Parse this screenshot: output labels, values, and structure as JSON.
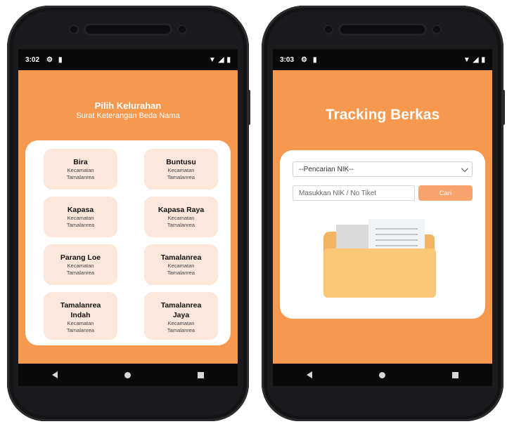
{
  "left_phone": {
    "status": {
      "time": "3:02"
    },
    "title": "Pilih Kelurahan",
    "subtitle": "Surat Keterangan Beda Nama",
    "kelurahan": [
      {
        "name": "Bira",
        "sub1": "Kecamatan",
        "sub2": "Tamalanrea"
      },
      {
        "name": "Buntusu",
        "sub1": "Kecamatan",
        "sub2": "Tamalanrea"
      },
      {
        "name": "Kapasa",
        "sub1": "Kecamatan",
        "sub2": "Tamalanrea"
      },
      {
        "name": "Kapasa Raya",
        "sub1": "Kecamatan",
        "sub2": "Tamalanrea"
      },
      {
        "name": "Parang Loe",
        "sub1": "Kecamatan",
        "sub2": "Tamalanrea"
      },
      {
        "name": "Tamalanrea",
        "sub1": "Kecamatan",
        "sub2": "Tamalanrea"
      },
      {
        "name_line1": "Tamalanrea",
        "name_line2": "Indah",
        "sub1": "Kecamatan",
        "sub2": "Tamalanrea"
      },
      {
        "name_line1": "Tamalanrea",
        "name_line2": "Jaya",
        "sub1": "Kecamatan",
        "sub2": "Tamalanrea"
      }
    ]
  },
  "right_phone": {
    "status": {
      "time": "3:03"
    },
    "title": "Tracking Berkas",
    "select": {
      "selected": "--Pencarian NIK--"
    },
    "search": {
      "placeholder": "Masukkan NIK / No Tiket",
      "button": "Cari"
    }
  },
  "colors": {
    "accent": "#f7984f",
    "tile": "#fde6da",
    "button": "#f7a36b",
    "folder": "#f8c272"
  },
  "icons": [
    "gear-icon",
    "sd-card-icon",
    "wifi-icon",
    "signal-icon",
    "battery-icon",
    "back-icon",
    "home-icon",
    "recent-apps-icon",
    "folder-illustration",
    "chevron-down-icon"
  ]
}
